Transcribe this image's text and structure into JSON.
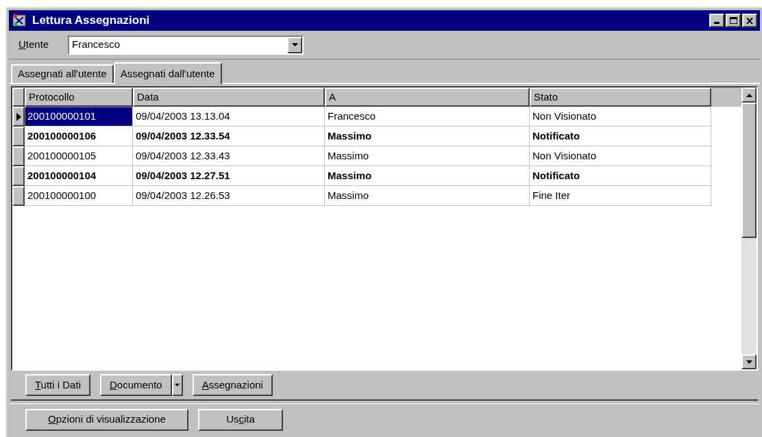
{
  "window": {
    "title": "Lettura Assegnazioni"
  },
  "user_field": {
    "label": {
      "key": "U",
      "post": "tente"
    },
    "value": "Francesco"
  },
  "tabs": [
    {
      "label": "Assegnati all'utente",
      "selected": false
    },
    {
      "label": "Assegnati dall'utente",
      "selected": true
    }
  ],
  "table": {
    "columns": [
      "Protocollo",
      "Data",
      "A",
      "Stato"
    ],
    "rows": [
      {
        "cells": [
          "200100000101",
          "09/04/2003 13.13.04",
          "Francesco",
          "Non Visionato"
        ],
        "selected": true,
        "bold": false
      },
      {
        "cells": [
          "200100000106",
          "09/04/2003 12.33.54",
          "Massimo",
          "Notificato"
        ],
        "selected": false,
        "bold": true
      },
      {
        "cells": [
          "200100000105",
          "09/04/2003 12.33.43",
          "Massimo",
          "Non Visionato"
        ],
        "selected": false,
        "bold": false
      },
      {
        "cells": [
          "200100000104",
          "09/04/2003 12.27.51",
          "Massimo",
          "Notificato"
        ],
        "selected": false,
        "bold": true
      },
      {
        "cells": [
          "200100000100",
          "09/04/2003 12.26.53",
          "Massimo",
          "Fine Iter"
        ],
        "selected": false,
        "bold": false
      }
    ]
  },
  "toolbar": [
    {
      "kind": "button",
      "label": {
        "key": "T",
        "post": "utti i Dati"
      }
    },
    {
      "kind": "split",
      "label": {
        "key": "D",
        "post": "ocumento"
      }
    },
    {
      "kind": "button",
      "label": {
        "key": "A",
        "post": "ssegnazioni"
      }
    }
  ],
  "footer": [
    {
      "kind": "button",
      "label": {
        "key": "O",
        "post": "pzioni di visualizzazione"
      }
    },
    {
      "kind": "button",
      "label": {
        "pre": "Us",
        "key": "c",
        "post": "ita"
      }
    }
  ]
}
